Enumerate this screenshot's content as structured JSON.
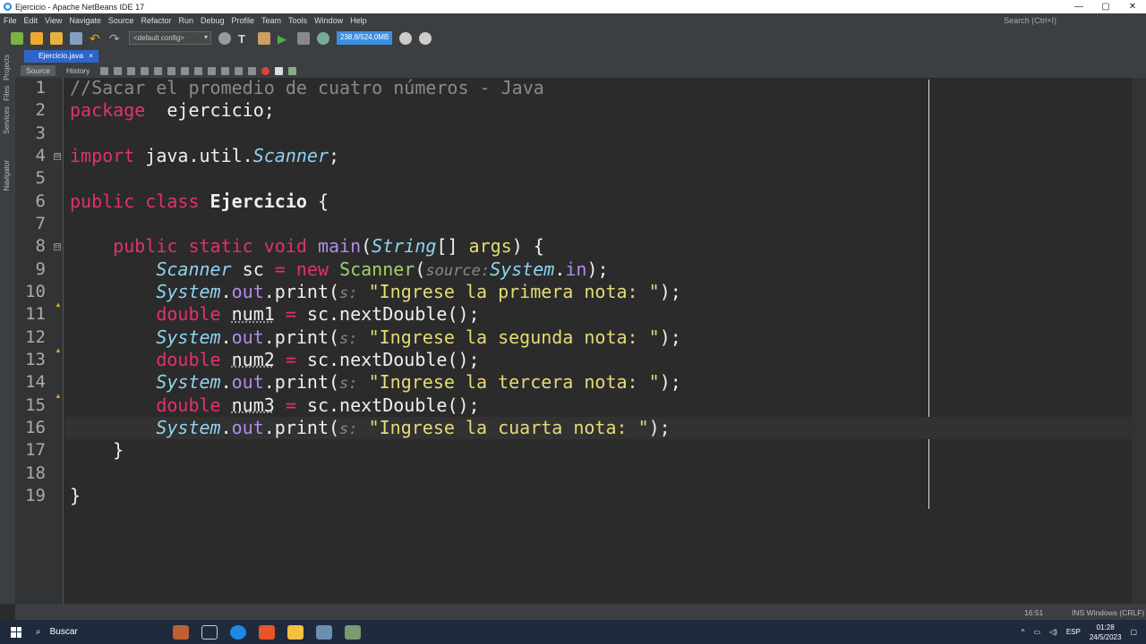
{
  "window": {
    "title": "Ejercicio - Apache NetBeans IDE 17"
  },
  "menu": [
    "File",
    "Edit",
    "View",
    "Navigate",
    "Source",
    "Refactor",
    "Run",
    "Debug",
    "Profile",
    "Team",
    "Tools",
    "Window",
    "Help"
  ],
  "search_placeholder": "Search (Ctrl+I)",
  "toolbar": {
    "config": "<default config>",
    "memory": "238,8/524,0MB"
  },
  "side_tabs": [
    "Projects",
    "Files",
    "Services",
    "Navigator"
  ],
  "file_tab": {
    "label": "Ejercicio.java",
    "close": "×"
  },
  "editor_tabs": {
    "source": "Source",
    "history": "History"
  },
  "code_lines": [
    [
      [
        "cm",
        "//Sacar el promedio de cuatro números - Java"
      ]
    ],
    [
      [
        "k",
        "package"
      ],
      [
        "",
        "  ejercicio;"
      ]
    ],
    [],
    [
      [
        "k",
        "import"
      ],
      [
        "",
        " java.util."
      ],
      [
        "t",
        "Scanner"
      ],
      [
        "",
        ";"
      ]
    ],
    [],
    [
      [
        "k",
        "public class"
      ],
      [
        "",
        " "
      ],
      [
        "b",
        "Ejercicio"
      ],
      [
        "",
        " {"
      ]
    ],
    [],
    [
      [
        "",
        ""
      ],
      [
        "k",
        "    public static void"
      ],
      [
        "",
        " "
      ],
      [
        "m",
        "main"
      ],
      [
        "",
        "("
      ],
      [
        "t",
        "String"
      ],
      [
        "",
        "[] "
      ],
      [
        "s",
        "args"
      ],
      [
        "",
        ") {"
      ]
    ],
    [
      [
        "t",
        "        Scanner"
      ],
      [
        "",
        " sc "
      ],
      [
        "k",
        "="
      ],
      [
        "",
        " "
      ],
      [
        "k",
        "new"
      ],
      [
        "",
        " "
      ],
      [
        "c",
        "Scanner"
      ],
      [
        "",
        "("
      ],
      [
        "h",
        "source:"
      ],
      [
        "t",
        "System"
      ],
      [
        "",
        "."
      ],
      [
        "f",
        "in"
      ],
      [
        "",
        ");"
      ]
    ],
    [
      [
        "t",
        "        System"
      ],
      [
        "",
        "."
      ],
      [
        "f",
        "out"
      ],
      [
        "",
        ".print("
      ],
      [
        "h",
        "s:"
      ],
      [
        "s",
        " \"Ingrese la primera nota: \""
      ],
      [
        "",
        ");"
      ]
    ],
    [
      [
        "k",
        "        double"
      ],
      [
        "",
        " "
      ],
      [
        "u",
        "num1"
      ],
      [
        "",
        " "
      ],
      [
        "k",
        "="
      ],
      [
        "",
        " sc.nextDouble();"
      ]
    ],
    [
      [
        "t",
        "        System"
      ],
      [
        "",
        "."
      ],
      [
        "f",
        "out"
      ],
      [
        "",
        ".print("
      ],
      [
        "h",
        "s:"
      ],
      [
        "s",
        " \"Ingrese la segunda nota: \""
      ],
      [
        "",
        ");"
      ]
    ],
    [
      [
        "k",
        "        double"
      ],
      [
        "",
        " "
      ],
      [
        "u",
        "num2"
      ],
      [
        "",
        " "
      ],
      [
        "k",
        "="
      ],
      [
        "",
        " sc.nextDouble();"
      ]
    ],
    [
      [
        "t",
        "        System"
      ],
      [
        "",
        "."
      ],
      [
        "f",
        "out"
      ],
      [
        "",
        ".print("
      ],
      [
        "h",
        "s:"
      ],
      [
        "s",
        " \"Ingrese la tercera nota: \""
      ],
      [
        "",
        ");"
      ]
    ],
    [
      [
        "k",
        "        double"
      ],
      [
        "",
        " "
      ],
      [
        "u",
        "num3"
      ],
      [
        "",
        " "
      ],
      [
        "k",
        "="
      ],
      [
        "",
        " sc.nextDouble();"
      ]
    ],
    [
      [
        "t",
        "        System"
      ],
      [
        "",
        "."
      ],
      [
        "f",
        "out"
      ],
      [
        "",
        ".print("
      ],
      [
        "h",
        "s:"
      ],
      [
        "s",
        " \"Ingrese la cuarta nota: \""
      ],
      [
        "",
        ");"
      ]
    ],
    [
      [
        "",
        "    }"
      ]
    ],
    [],
    [
      [
        "",
        "}"
      ]
    ]
  ],
  "status": {
    "position": "16:51",
    "mode": "INS",
    "line_endings": "Windows (CRLF)"
  },
  "taskbar": {
    "search": "Buscar",
    "lang": "ESP",
    "time": "01:28",
    "date": "24/5/2023"
  }
}
